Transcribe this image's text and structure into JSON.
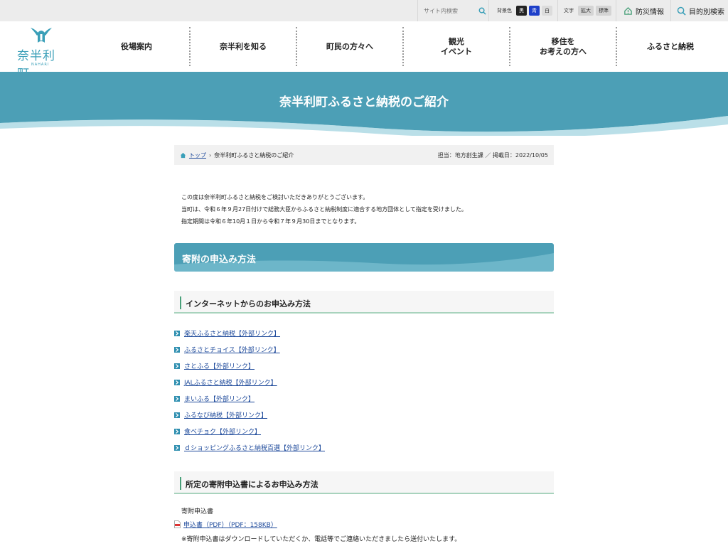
{
  "utility": {
    "search_placeholder": "サイト内検索",
    "bg_label": "背景色",
    "bg_options": [
      "黒",
      "青",
      "白"
    ],
    "text_label": "文字",
    "text_options": [
      "拡大",
      "標準"
    ],
    "disaster": "防災情報",
    "purpose_search": "目的別検索"
  },
  "logo": {
    "name": "奈半利町",
    "roman": "NAHARI"
  },
  "nav": {
    "items": [
      {
        "label": "役場案内"
      },
      {
        "label": "奈半利を知る"
      },
      {
        "label": "町民の方々へ"
      },
      {
        "line1": "観光",
        "line2": "イベント"
      },
      {
        "line1": "移住を",
        "line2": "お考えの方へ"
      },
      {
        "label": "ふるさと納税"
      }
    ]
  },
  "page_title": "奈半利町ふるさと納税のご紹介",
  "breadcrumb": {
    "home": "トップ",
    "current": "奈半利町ふるさと納税のご紹介",
    "meta": "担当：地方創生課 ／ 掲載日：2022/10/05"
  },
  "intro": [
    "この度は奈半利町ふるさと納税をご検討いただきありがとうございます。",
    "当町は、令和６年９月27日付けで総務大臣からふるさと納税制度に適合する地方団体として指定を受けました。",
    "指定期間は令和６年10月１日から令和７年９月30日までとなります。"
  ],
  "section_title": "寄附の申込み方法",
  "internet_heading": "インターネットからのお申込み方法",
  "internet_links": [
    "楽天ふるさと納税【外部リンク】",
    "ふるさとチョイス【外部リンク】",
    "さとふる【外部リンク】",
    "JALふるさと納税【外部リンク】",
    "まいふる【外部リンク】",
    "ふるなび納税【外部リンク】",
    "食べチョク【外部リンク】",
    "ｄショッピングふるさと納税百選【外部リンク】"
  ],
  "form_heading": "所定の寄附申込書によるお申込み方法",
  "form_label": "寄附申込書",
  "pdf_link": "申込書（PDF）（PDF：158KB）",
  "note": "※寄附申込書はダウンロードしていただくか、電話等でご連絡いただきましたら送付いたします。",
  "colors": {
    "accent": "#4c9fb6",
    "link": "#1e4a9b",
    "heading_line": "#a8d3bd"
  }
}
